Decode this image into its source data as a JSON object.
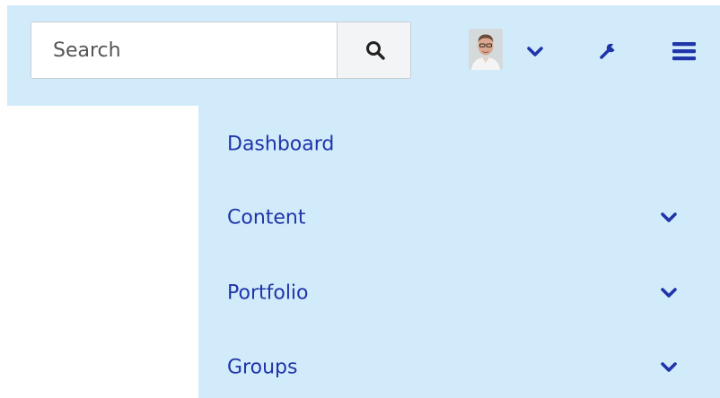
{
  "header": {
    "search": {
      "placeholder": "Search",
      "value": ""
    },
    "icons": {
      "search": "search-icon",
      "user_menu": "chevron-down-icon",
      "admin": "wrench-icon",
      "main_menu": "hamburger-menu-icon"
    }
  },
  "nav": {
    "items": [
      {
        "label": "Dashboard",
        "has_submenu": false
      },
      {
        "label": "Content",
        "has_submenu": true
      },
      {
        "label": "Portfolio",
        "has_submenu": true
      },
      {
        "label": "Groups",
        "has_submenu": true
      }
    ]
  },
  "colors": {
    "header_bg": "#d2ebfb",
    "nav_bg": "#d2ebfb",
    "accent": "#1f35a8",
    "icon_dark": "#222222"
  }
}
